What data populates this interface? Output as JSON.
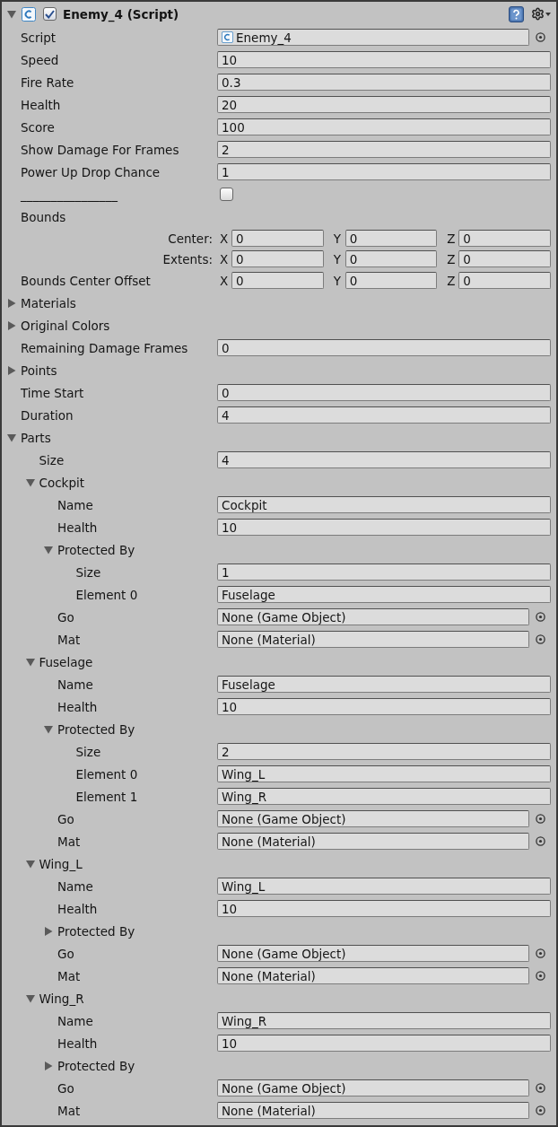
{
  "component": {
    "title": "Enemy_4 (Script)",
    "expanded": true,
    "enabled": true
  },
  "fields": [
    {
      "kind": "script",
      "label": "Script",
      "value": "Enemy_4"
    },
    {
      "kind": "text",
      "label": "Speed",
      "value": "10"
    },
    {
      "kind": "text",
      "label": "Fire Rate",
      "value": "0.3"
    },
    {
      "kind": "text",
      "label": "Health",
      "value": "20"
    },
    {
      "kind": "text",
      "label": "Score",
      "value": "100"
    },
    {
      "kind": "text",
      "label": "Show Damage For Frames",
      "value": "2"
    },
    {
      "kind": "text",
      "label": "Power Up Drop Chance",
      "value": "1"
    },
    {
      "kind": "toggle",
      "label": "________________",
      "checked": false
    },
    {
      "kind": "bounds",
      "label": "Bounds",
      "rows": [
        {
          "label": "Center:",
          "components": [
            {
              "axis": "X",
              "value": "0"
            },
            {
              "axis": "Y",
              "value": "0"
            },
            {
              "axis": "Z",
              "value": "0"
            }
          ]
        },
        {
          "label": "Extents:",
          "components": [
            {
              "axis": "X",
              "value": "0"
            },
            {
              "axis": "Y",
              "value": "0"
            },
            {
              "axis": "Z",
              "value": "0"
            }
          ]
        }
      ]
    },
    {
      "kind": "vector",
      "label": "Bounds Center Offset",
      "components": [
        {
          "axis": "X",
          "value": "0"
        },
        {
          "axis": "Y",
          "value": "0"
        },
        {
          "axis": "Z",
          "value": "0"
        }
      ]
    },
    {
      "kind": "foldout",
      "label": "Materials",
      "expanded": false
    },
    {
      "kind": "foldout",
      "label": "Original Colors",
      "expanded": false
    },
    {
      "kind": "text",
      "label": "Remaining Damage Frames",
      "value": "0"
    },
    {
      "kind": "foldout",
      "label": "Points",
      "expanded": false
    },
    {
      "kind": "text",
      "label": "Time Start",
      "value": "0"
    },
    {
      "kind": "text",
      "label": "Duration",
      "value": "4"
    },
    {
      "kind": "foldout",
      "label": "Parts",
      "expanded": true,
      "children": [
        {
          "kind": "text",
          "label": "Size",
          "value": "4"
        },
        {
          "kind": "foldout",
          "label": "Cockpit",
          "expanded": true,
          "children": [
            {
              "kind": "text",
              "label": "Name",
              "value": "Cockpit"
            },
            {
              "kind": "text",
              "label": "Health",
              "value": "10"
            },
            {
              "kind": "foldout",
              "label": "Protected By",
              "expanded": true,
              "children": [
                {
                  "kind": "text",
                  "label": "Size",
                  "value": "1"
                },
                {
                  "kind": "text",
                  "label": "Element 0",
                  "value": "Fuselage"
                }
              ]
            },
            {
              "kind": "object",
              "label": "Go",
              "value": "None (Game Object)"
            },
            {
              "kind": "object",
              "label": "Mat",
              "value": "None (Material)"
            }
          ]
        },
        {
          "kind": "foldout",
          "label": "Fuselage",
          "expanded": true,
          "children": [
            {
              "kind": "text",
              "label": "Name",
              "value": "Fuselage"
            },
            {
              "kind": "text",
              "label": "Health",
              "value": "10"
            },
            {
              "kind": "foldout",
              "label": "Protected By",
              "expanded": true,
              "children": [
                {
                  "kind": "text",
                  "label": "Size",
                  "value": "2"
                },
                {
                  "kind": "text",
                  "label": "Element 0",
                  "value": "Wing_L"
                },
                {
                  "kind": "text",
                  "label": "Element 1",
                  "value": "Wing_R"
                }
              ]
            },
            {
              "kind": "object",
              "label": "Go",
              "value": "None (Game Object)"
            },
            {
              "kind": "object",
              "label": "Mat",
              "value": "None (Material)"
            }
          ]
        },
        {
          "kind": "foldout",
          "label": "Wing_L",
          "expanded": true,
          "children": [
            {
              "kind": "text",
              "label": "Name",
              "value": "Wing_L"
            },
            {
              "kind": "text",
              "label": "Health",
              "value": "10"
            },
            {
              "kind": "foldout",
              "label": "Protected By",
              "expanded": false
            },
            {
              "kind": "object",
              "label": "Go",
              "value": "None (Game Object)"
            },
            {
              "kind": "object",
              "label": "Mat",
              "value": "None (Material)"
            }
          ]
        },
        {
          "kind": "foldout",
          "label": "Wing_R",
          "expanded": true,
          "children": [
            {
              "kind": "text",
              "label": "Name",
              "value": "Wing_R"
            },
            {
              "kind": "text",
              "label": "Health",
              "value": "10"
            },
            {
              "kind": "foldout",
              "label": "Protected By",
              "expanded": false
            },
            {
              "kind": "object",
              "label": "Go",
              "value": "None (Game Object)"
            },
            {
              "kind": "object",
              "label": "Mat",
              "value": "None (Material)"
            }
          ]
        }
      ]
    }
  ]
}
